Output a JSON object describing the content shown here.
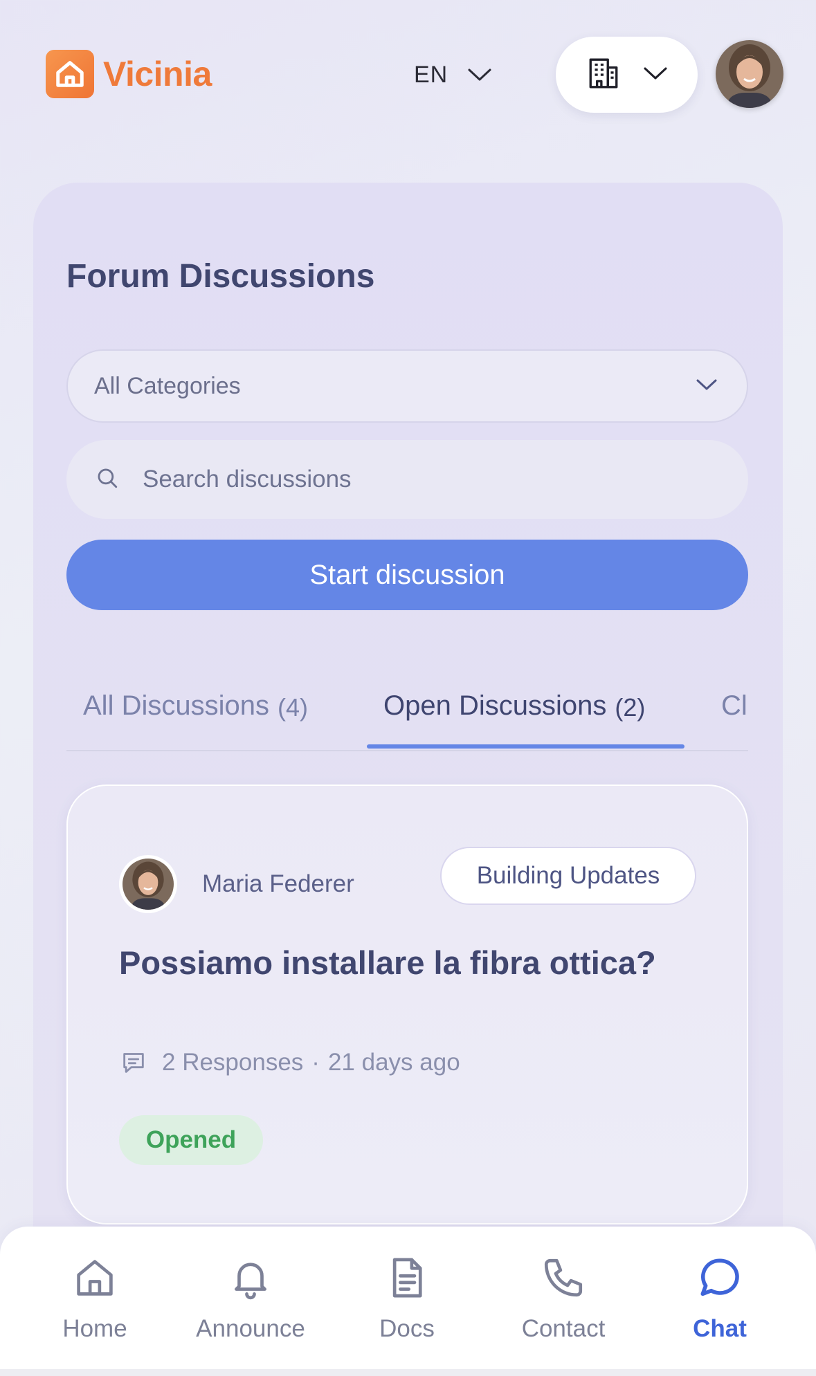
{
  "header": {
    "brand": "Vicinia",
    "language": "EN",
    "logo_color": "#ef7a3a"
  },
  "page": {
    "title": "Forum Discussions"
  },
  "filters": {
    "category_selected": "All Categories",
    "search_placeholder": "Search discussions"
  },
  "actions": {
    "start_label": "Start discussion",
    "accent_color": "#6486e6"
  },
  "tabs": [
    {
      "label": "All Discussions",
      "count": "(4)",
      "active": false
    },
    {
      "label": "Open Discussions",
      "count": "(2)",
      "active": true
    },
    {
      "label": "Cl",
      "count": "",
      "active": false
    }
  ],
  "discussions": [
    {
      "author": "Maria Federer",
      "category": "Building Updates",
      "title": "Possiamo installare la fibra ottica?",
      "responses": "2 Responses",
      "separator": "·",
      "age": "21 days ago",
      "status": "Opened",
      "status_color": "#3ea35a"
    }
  ],
  "nav": [
    {
      "label": "Home",
      "icon": "home-icon",
      "active": false
    },
    {
      "label": "Announce",
      "icon": "bell-icon",
      "active": false
    },
    {
      "label": "Docs",
      "icon": "document-icon",
      "active": false
    },
    {
      "label": "Contact",
      "icon": "phone-icon",
      "active": false
    },
    {
      "label": "Chat",
      "icon": "chat-bubble-icon",
      "active": true
    }
  ]
}
